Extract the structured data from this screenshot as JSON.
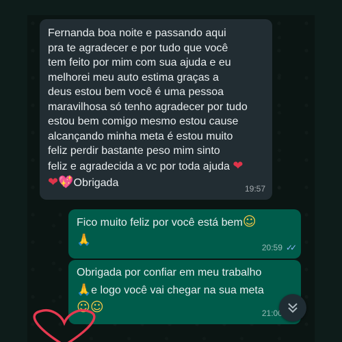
{
  "chat": {
    "incoming": {
      "text": "Fernanda boa noite e passando aqui\npra te agradecer e por tudo que você\ntem feito por mim com sua ajuda e eu\nmelhorei meu auto estima graças a\ndeus estou bem você é uma pessoa\nmaravilhosa só tenho agradecer por tudo\nestou bem comigo  mesmo estou cause\nalcançando  minha meta é estou muito\nfeliz perdir bastante  peso mim sinto\nfeliz e agradecida a vc por toda ajuda",
      "signoff": "Obrigada",
      "time": "19:57"
    },
    "outgoing": [
      {
        "text": "Fico muito feliz por você está bem",
        "time": "20:59"
      },
      {
        "line1": "Obrigada por confiar em meu trabalho",
        "line2": "e logo você vai chegar na sua meta",
        "time": "21:00"
      }
    ]
  },
  "colors": {
    "incoming_bubble": "#222d33",
    "outgoing_bubble": "#005c4b",
    "read_ticks": "#8fb9ff",
    "background": "#0b1513"
  },
  "icons": {
    "scroll_down": "double-chevron-down-icon",
    "read_receipt": "double-check-icon"
  }
}
